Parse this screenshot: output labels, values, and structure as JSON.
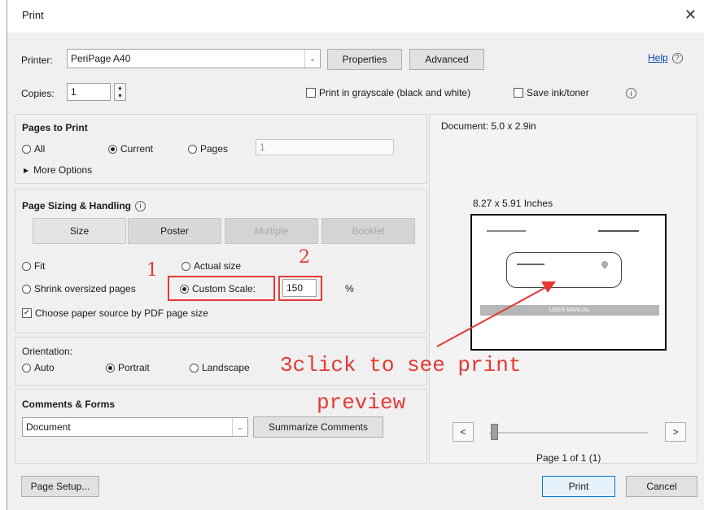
{
  "window": {
    "title": "Print",
    "close_glyph": "✕"
  },
  "printer": {
    "label": "Printer:",
    "value": "PeriPage A40",
    "properties_label": "Properties",
    "advanced_label": "Advanced",
    "help_label": "Help",
    "help_icon": "?"
  },
  "copies": {
    "label": "Copies:",
    "value": "1"
  },
  "options": {
    "grayscale_label": "Print in grayscale (black and white)",
    "save_ink_label": "Save ink/toner",
    "info_icon": "i"
  },
  "pages_to_print": {
    "title": "Pages to Print",
    "all_label": "All",
    "current_label": "Current",
    "pages_label": "Pages",
    "pages_value": "1",
    "selected": "current",
    "more_options_label": "More Options",
    "more_options_glyph": "▶"
  },
  "sizing": {
    "title": "Page Sizing & Handling",
    "info_icon": "i",
    "tabs": [
      {
        "label": "Size",
        "state": "active"
      },
      {
        "label": "Poster",
        "state": "normal"
      },
      {
        "label": "Multiple",
        "state": "disabled"
      },
      {
        "label": "Booklet",
        "state": "disabled"
      }
    ],
    "fit_label": "Fit",
    "actual_size_label": "Actual size",
    "shrink_label": "Shrink oversized pages",
    "custom_scale_label": "Custom Scale:",
    "custom_scale_value": "150",
    "percent": "%",
    "paper_source_label": "Choose paper source by PDF page size",
    "selected": "custom"
  },
  "orientation": {
    "title": "Orientation:",
    "auto_label": "Auto",
    "portrait_label": "Portrait",
    "landscape_label": "Landscape",
    "selected": "portrait"
  },
  "comments": {
    "title": "Comments & Forms",
    "value": "Document",
    "summarize_label": "Summarize Comments"
  },
  "preview": {
    "document_size": "Document: 5.0 x 2.9in",
    "paper_size": "8.27 x 5.91 Inches",
    "page_indicator": "Page 1 of 1 (1)",
    "prev_glyph": "<",
    "next_glyph": ">",
    "banner_text": "USER MANUAL"
  },
  "footer": {
    "page_setup_label": "Page Setup...",
    "print_label": "Print",
    "cancel_label": "Cancel"
  },
  "annotations": {
    "num1": "1",
    "num2": "2",
    "line1": "3click to see print",
    "line2": "preview",
    "color": "#e53935"
  }
}
